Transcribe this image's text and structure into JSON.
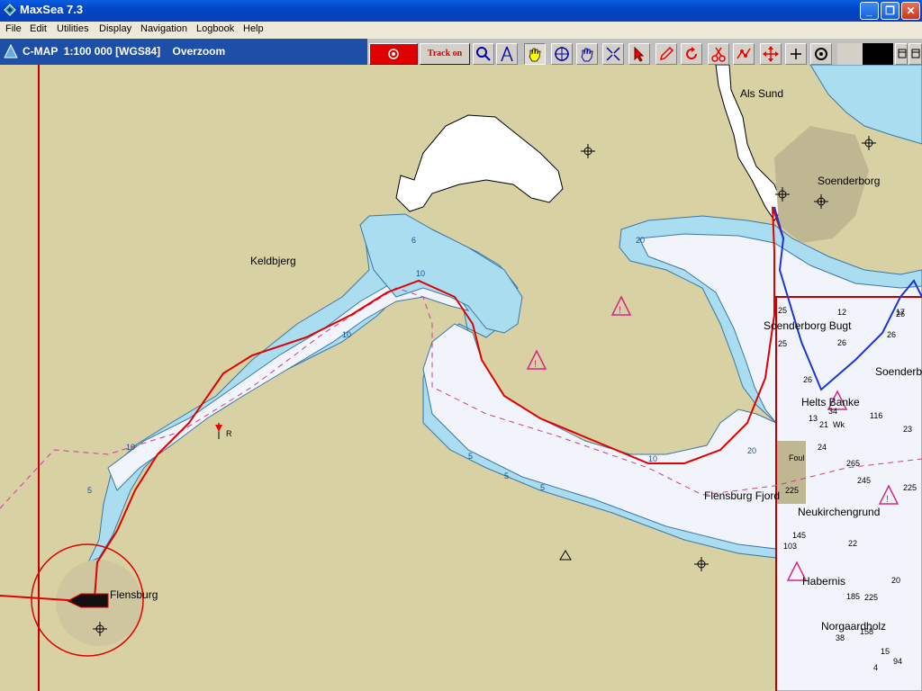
{
  "window": {
    "title": "MaxSea 7.3"
  },
  "menu": [
    "File",
    "Edit",
    "Utilities",
    "Display",
    "Navigation",
    "Logbook",
    "Help"
  ],
  "chartbar": {
    "label": "C-MAP  1:100 000 [WGS84]    Overzoom"
  },
  "toolbar": {
    "track_label": "Track on"
  },
  "map": {
    "places": {
      "als_sund": "Als Sund",
      "soenderborg": "Soenderborg",
      "keldbjerg": "Keldbjerg",
      "soenderborg_bugt": "Soenderborg Bugt",
      "soenderb": "Soenderb",
      "helts_banke": "Helts Banke",
      "flensburg_fjord": "Flensburg Fjord",
      "neukirchengrund": "Neukirchengrund",
      "habernis": "Habernis",
      "norgaardholz": "Norgaardholz",
      "flensburg": "Flensburg",
      "foul": "Foul",
      "wk": "Wk",
      "buoy_r": "R"
    },
    "contours": {
      "c10a": "10",
      "c10b": "10",
      "c10c": "10",
      "c10d": "10",
      "c5a": "5",
      "c5b": "5",
      "c5c": "5",
      "c5d": "5",
      "c6": "6",
      "c20a": "20",
      "c20b": "20"
    },
    "soundings": [
      "25",
      "12",
      "26",
      "25",
      "26",
      "17",
      "26",
      "26",
      "34",
      "116",
      "13",
      "21",
      "24",
      "23",
      "265",
      "245",
      "22",
      "225",
      "145",
      "103",
      "225",
      "185",
      "225",
      "20",
      "158",
      "38",
      "15",
      "94",
      "4"
    ]
  }
}
